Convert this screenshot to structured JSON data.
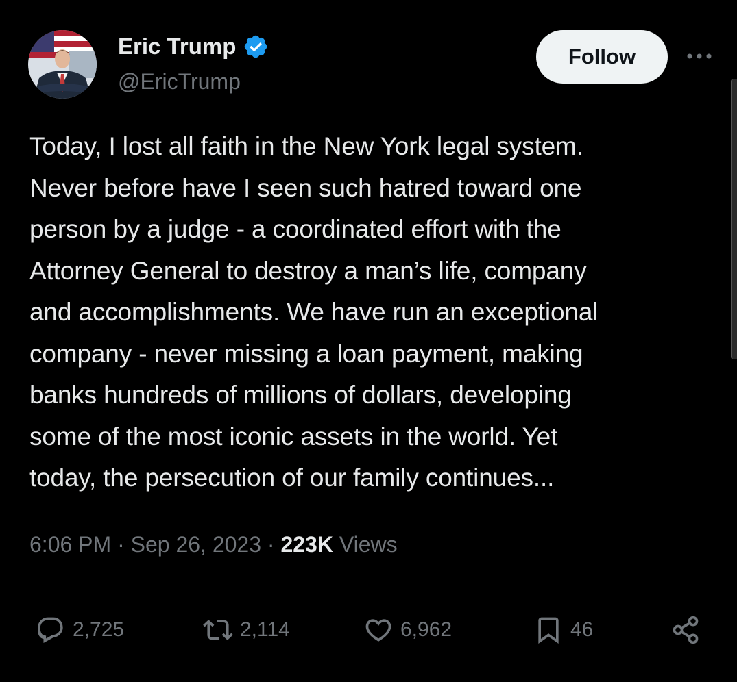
{
  "user": {
    "display_name": "Eric Trump",
    "handle": "@EricTrump",
    "verified": true
  },
  "header": {
    "follow_label": "Follow"
  },
  "tweet": {
    "text": "Today, I lost all faith in the New York legal system.\nNever before have I seen such hatred toward one\nperson by a judge - a coordinated effort with the\nAttorney General to destroy a man’s life, company\nand accomplishments. We have run an exceptional\ncompany - never missing a loan payment, making\nbanks hundreds of millions of dollars, developing\nsome of the most iconic assets in the world. Yet\ntoday, the persecution of our family continues...",
    "time": "6:06 PM",
    "date": "Sep 26, 2023",
    "views_count": "223K",
    "views_label": "Views"
  },
  "actions": {
    "replies": "2,725",
    "reposts": "2,114",
    "likes": "6,962",
    "bookmarks": "46"
  },
  "icons": {
    "verified": "verified-badge-icon",
    "more": "more-dots-icon",
    "reply": "reply-icon",
    "repost": "repost-icon",
    "like": "heart-icon",
    "bookmark": "bookmark-icon",
    "share": "share-icon"
  },
  "colors": {
    "background": "#000000",
    "text_primary": "#e7e9ea",
    "text_secondary": "#71767b",
    "verified_blue": "#1d9bf0",
    "follow_bg": "#eff3f4",
    "divider": "#2f3336"
  }
}
